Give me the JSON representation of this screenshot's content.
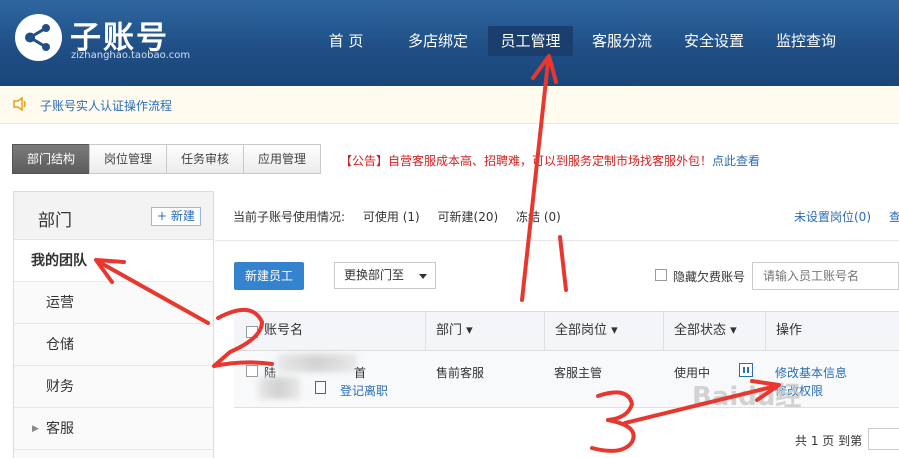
{
  "header": {
    "title": "子账号",
    "subtitle": "zizhanghao.taobao.com",
    "nav": [
      "首 页",
      "多店绑定",
      "员工管理",
      "客服分流",
      "安全设置",
      "监控查询"
    ],
    "active_nav": "员工管理"
  },
  "notice": {
    "text": "子账号实人认证操作流程"
  },
  "tabs": [
    "部门结构",
    "岗位管理",
    "任务审核",
    "应用管理"
  ],
  "announcement": {
    "text": "【公告】自营客服成本高、招聘难，可以到服务定制市场找客服外包！",
    "link": "点此查看"
  },
  "sidebar": {
    "title": "部门",
    "new_button": "+ 新建",
    "team": "我的团队",
    "items": [
      "运营",
      "仓储",
      "财务",
      "客服"
    ]
  },
  "usage": {
    "prefix": "当前子账号使用情况:",
    "available": "可使用 (1)",
    "creatable": "可新建(20)",
    "frozen": "冻结 (0)",
    "unassigned": "未设置岗位(0)",
    "more": "查"
  },
  "toolbar": {
    "new_employee": "新建员工",
    "change_dept": "更换部门至",
    "hide_label": "隐藏欠费账号",
    "search_placeholder": "请输入员工账号名"
  },
  "table": {
    "headers": [
      "账号名",
      "部门 ▾",
      "全部岗位 ▾",
      "全部状态 ▾",
      "操作"
    ],
    "row": {
      "name_partial": "陆",
      "name_suffix": "首",
      "register_leave": "登记离职",
      "department": "售前客服",
      "position": "客服主管",
      "status": "使用中",
      "action_edit": "修改基本信息",
      "action_permission": "修改权限"
    }
  },
  "pager": {
    "text": "共 1 页 到第"
  },
  "annotations": {
    "labels": [
      "1",
      "2",
      "3"
    ],
    "color": "#e8372f"
  },
  "watermark": "Baidu经"
}
